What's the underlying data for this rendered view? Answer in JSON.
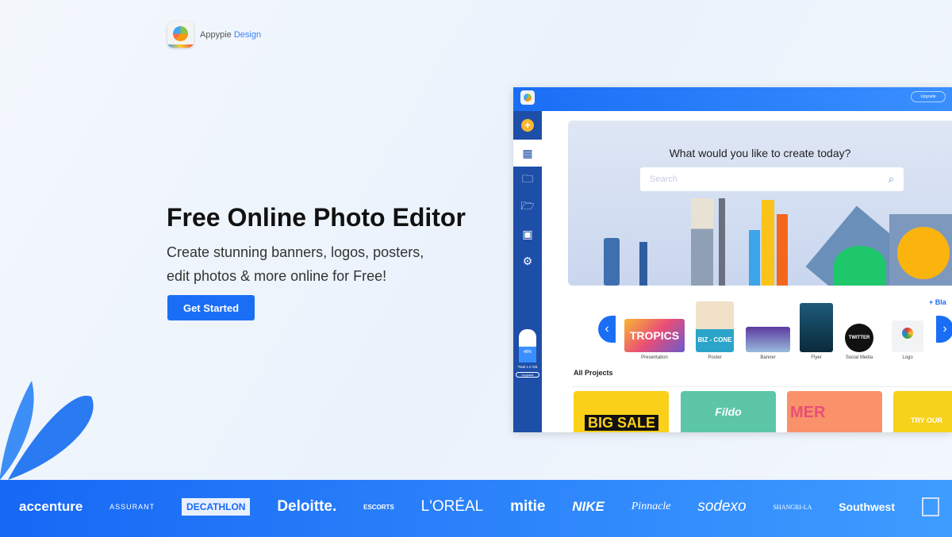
{
  "header": {
    "brand_name": "Appypie",
    "brand_suffix": "Design"
  },
  "hero": {
    "title": "Free Online Photo Editor",
    "subtitle_line1": "Create stunning banners, logos, posters,",
    "subtitle_line2": "edit photos & more online for Free!",
    "cta_label": "Get Started"
  },
  "mockup": {
    "upgrade_label": "Upgrade",
    "storage": {
      "percent": "48%",
      "fraction": 0.48,
      "total": "Total 1.0 GB"
    },
    "heading": "What would you like to create today?",
    "search_placeholder": "Search",
    "blank_label": "+ Bla",
    "categories": [
      {
        "label": "Presentation"
      },
      {
        "label": "Poster"
      },
      {
        "label": "Banner"
      },
      {
        "label": "Flyer"
      },
      {
        "label": "Social Media"
      },
      {
        "label": "Logo"
      }
    ],
    "thumbs": {
      "tropics": "TROPICS",
      "bizcone": "BIZ - CONE",
      "twitter": "TWITTER"
    },
    "all_projects": "All Projects",
    "projects": [
      {
        "text": "BIG SALE"
      },
      {
        "text": "Fildo"
      },
      {
        "text": "MER"
      },
      {
        "text": "TRY OUR"
      }
    ]
  },
  "brands": [
    "accenture",
    "ASSURANT",
    "DECATHLON",
    "Deloitte.",
    "ESCORTS",
    "L'ORÉAL",
    "mitie",
    "NIKE",
    "Pinnacle",
    "sodexo",
    "SHANGRI-LA",
    "Southwest"
  ],
  "colors": {
    "primary": "#1a6ef5",
    "sidebar": "#1e4fa8",
    "accent_yellow": "#f7b731"
  }
}
